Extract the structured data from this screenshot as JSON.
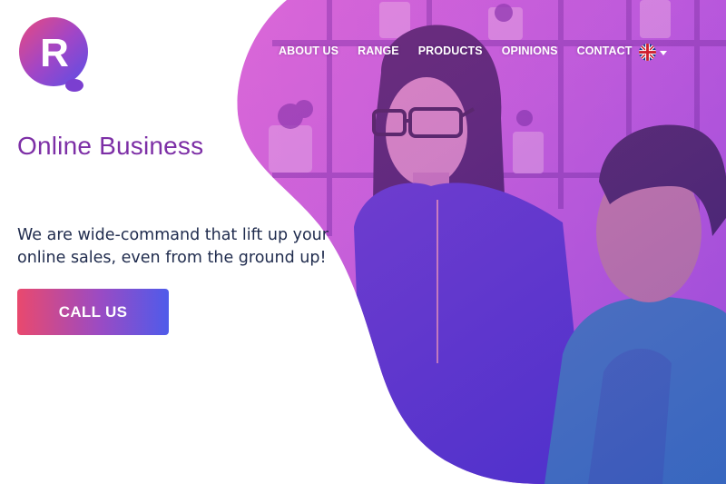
{
  "brand": {
    "logo_letter": "R",
    "colors": {
      "primary_purple": "#7d2fa6",
      "gradient_pink": "#e9496e",
      "gradient_blue": "#4f5bea",
      "text_dark": "#1f2b4d"
    }
  },
  "nav": {
    "items": [
      {
        "label": "ABOUT US"
      },
      {
        "label": "RANGE"
      },
      {
        "label": "PRODUCTS"
      },
      {
        "label": "OPINIONS"
      },
      {
        "label": "CONTACT"
      }
    ],
    "language": {
      "icon": "uk-flag-icon",
      "dropdown_icon": "caret-down-icon"
    }
  },
  "hero": {
    "title": "Online Business",
    "text": "We are wide-command that lift up your online sales, even from the ground up!",
    "cta_label": "CALL US",
    "photo_icon": "team-photo"
  }
}
